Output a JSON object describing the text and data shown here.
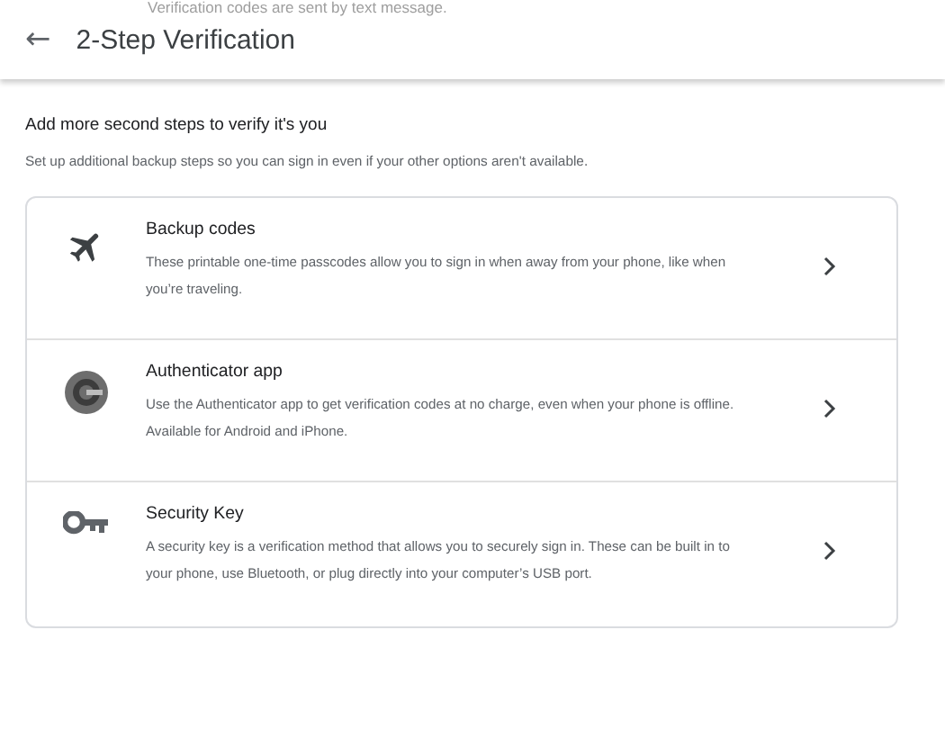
{
  "background_text": "Verification codes are sent by text message.",
  "header": {
    "back_icon": "←",
    "title": "2-Step Verification"
  },
  "section": {
    "heading": "Add more second steps to verify it's you",
    "subheading": "Set up additional backup steps so you can sign in even if your other options aren't available."
  },
  "options": [
    {
      "kind": "plane",
      "title": "Backup codes",
      "description": "These printable one-time passcodes allow you to sign in when away from your phone, like when you’re traveling."
    },
    {
      "kind": "authenticator",
      "title": "Authenticator app",
      "description": "Use the Authenticator app to get verification codes at no charge, even when your phone is offline. Available for Android and iPhone."
    },
    {
      "kind": "key",
      "title": "Security Key",
      "description": "A security key is a verification method that allows you to securely sign in. These can be built in to your phone, use Bluetooth, or plug directly into your computer’s USB port."
    }
  ]
}
